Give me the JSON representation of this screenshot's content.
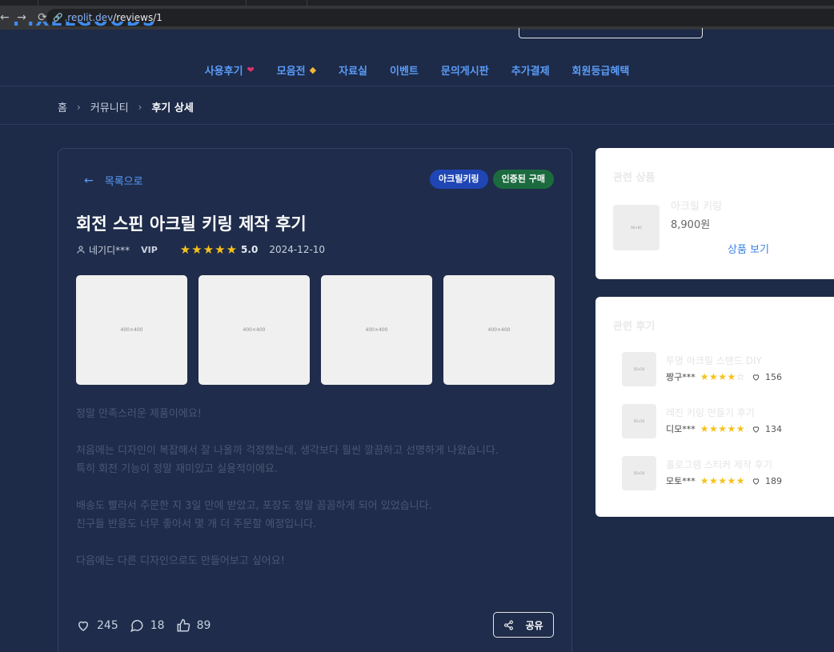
{
  "browser": {
    "url_host": ".replit.dev",
    "url_path": "/reviews/1"
  },
  "header": {
    "logo_text": "PIXELGOODS",
    "nav": [
      {
        "label": "사용후기",
        "emoji": "💝"
      },
      {
        "label": "모음전",
        "emoji": "🏷"
      },
      {
        "label": "자료실",
        "emoji": ""
      },
      {
        "label": "이벤트",
        "emoji": ""
      },
      {
        "label": "문의게시판",
        "emoji": ""
      },
      {
        "label": "추가결제",
        "emoji": ""
      },
      {
        "label": "회원등급혜택",
        "emoji": ""
      }
    ]
  },
  "breadcrumb": {
    "home": "홈",
    "community": "커뮤니티",
    "current": "후기 상세"
  },
  "review": {
    "back_label": "목록으로",
    "tags": [
      "아크릴키링",
      "인증된 구매"
    ],
    "title": "회전 스핀 아크릴 키링 제작 후기",
    "author": "네기디***",
    "grade": "VIP",
    "rating": 5,
    "rating_text": "5.0",
    "date": "2024-12-10",
    "images": [
      "400×400",
      "400×400",
      "400×400",
      "400×400"
    ],
    "body": [
      "정말 만족스러운 제품이에요!",
      "처음에는 디자인이 복잡해서 잘 나올까 걱정했는데, 생각보다 훨씬 깔끔하고 선명하게 나왔습니다.\n특히 회전 기능이 정말 재미있고 실용적이에요.",
      "배송도 빨라서 주문한 지 3일 만에 받았고, 포장도 정말 꼼꼼하게 되어 있었습니다.\n친구들 반응도 너무 좋아서 몇 개 더 주문할 예정입니다.",
      "다음에는 다른 디자인으로도 만들어보고 싶어요!"
    ],
    "likes": "245",
    "comments": "18",
    "thumbs": "89",
    "share_label": "공유"
  },
  "related_product": {
    "title": "관련 상품",
    "name": "아크릴 키링",
    "price": "8,900원",
    "link_label": "상품 보기",
    "thumb": "60×60"
  },
  "related_reviews": {
    "title": "관련 후기",
    "items": [
      {
        "title": "투명 아크릴 스탠드 DIY",
        "author": "짱구***",
        "rating": 4,
        "likes": "156",
        "thumb": "50×50"
      },
      {
        "title": "레진 키링 만들기 후기",
        "author": "디모***",
        "rating": 5,
        "likes": "134",
        "thumb": "50×50"
      },
      {
        "title": "홀로그램 스티커 제작 후기",
        "author": "모토***",
        "rating": 5,
        "likes": "189",
        "thumb": "50×50"
      }
    ]
  },
  "colors": {
    "page_bg": "#1d2a48",
    "accent": "#5a9cf8",
    "star": "#f6c21a",
    "tag_acrylic": "#1f46b4",
    "tag_verified": "#1b6b3f"
  }
}
